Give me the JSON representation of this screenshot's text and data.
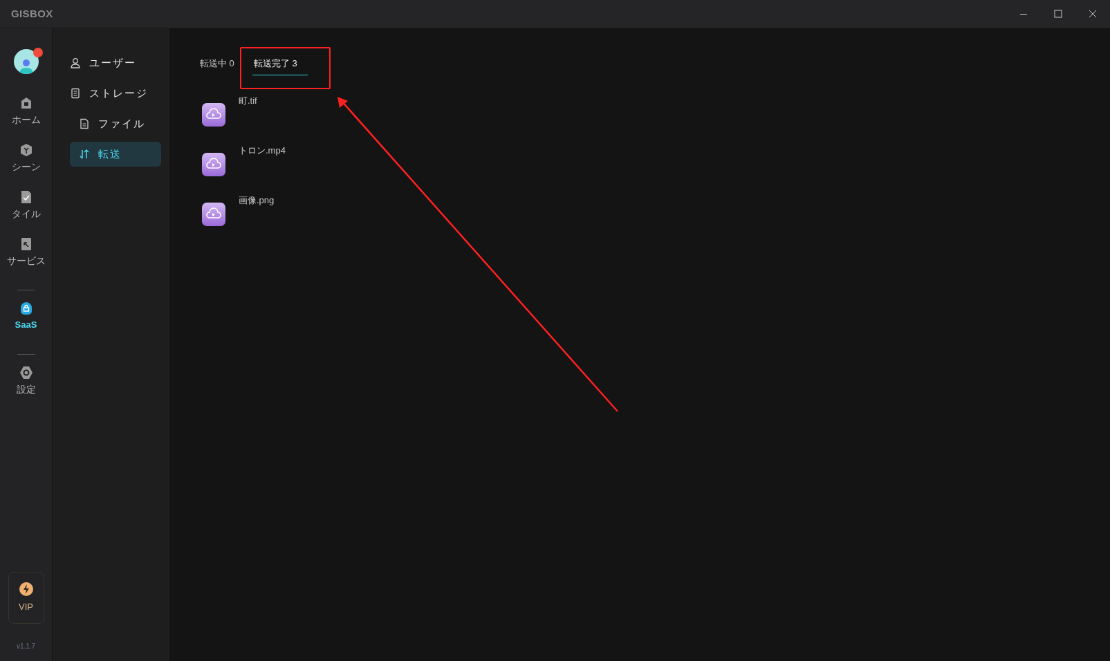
{
  "window": {
    "logo": "GISBOX"
  },
  "rail": {
    "items": [
      {
        "kind": "home",
        "label": "ホーム",
        "selected": false
      },
      {
        "kind": "scene",
        "label": "シーン",
        "selected": false
      },
      {
        "kind": "tile",
        "label": "タイル",
        "selected": false
      },
      {
        "kind": "service",
        "label": "サービス",
        "selected": false
      },
      {
        "kind": "divider"
      },
      {
        "kind": "saas",
        "label": "SaaS",
        "selected": true
      },
      {
        "kind": "divider"
      },
      {
        "kind": "settings",
        "label": "設定",
        "selected": false
      }
    ],
    "vip": "VIP",
    "version": "v1.1.7"
  },
  "sidebar": {
    "items": [
      {
        "kind": "user",
        "label": "ユーザー",
        "selected": false
      },
      {
        "kind": "storage",
        "label": "ストレージ",
        "selected": false
      },
      {
        "kind": "file",
        "label": "ファイル",
        "selected": false
      },
      {
        "kind": "transfer",
        "label": "転送",
        "selected": true
      }
    ]
  },
  "tabs": [
    {
      "label": "転送中 0",
      "selected": false
    },
    {
      "label": "転送完了 3",
      "selected": true
    }
  ],
  "files": [
    {
      "name": "町.tif"
    },
    {
      "name": "トロン.mp4"
    },
    {
      "name": "画像.png"
    }
  ]
}
